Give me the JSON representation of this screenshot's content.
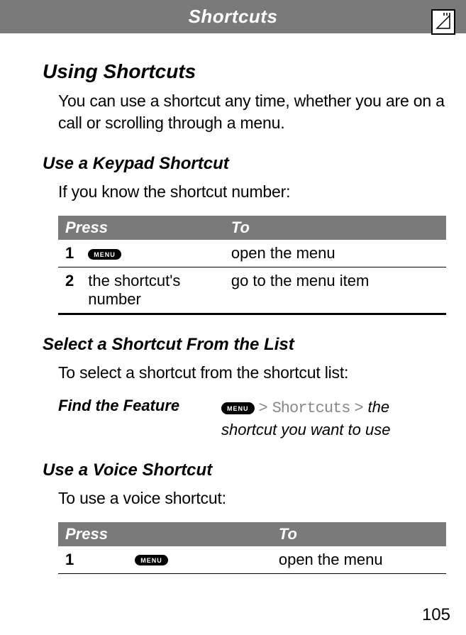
{
  "header": {
    "title": "Shortcuts"
  },
  "section1": {
    "heading": "Using Shortcuts",
    "intro": "You can use a shortcut any time, whether you are on a call or scrolling through a menu."
  },
  "section2": {
    "heading": "Use a Keypad Shortcut",
    "intro": "If you know the shortcut number:",
    "table": {
      "col1": "Press",
      "col2": "To",
      "rows": [
        {
          "num": "1",
          "press_key": "MENU",
          "press_text": "",
          "to": "open the menu"
        },
        {
          "num": "2",
          "press_key": "",
          "press_text": "the shortcut's number",
          "to": "go to the menu item"
        }
      ]
    }
  },
  "section3": {
    "heading": "Select a Shortcut From the List",
    "intro": "To select a shortcut from the shortcut list:",
    "find_label": "Find the Feature",
    "menu_key": "MENU",
    "gt1": ">",
    "path_link": "Shortcuts",
    "gt2": ">",
    "path_rest": "the shortcut you want to use"
  },
  "section4": {
    "heading": "Use a Voice Shortcut",
    "intro": "To use a voice shortcut:",
    "table": {
      "col1": "Press",
      "col2": "To",
      "rows": [
        {
          "num": "1",
          "press_key": "MENU",
          "press_text": "",
          "to": "open the menu"
        }
      ]
    }
  },
  "page_number": "105"
}
